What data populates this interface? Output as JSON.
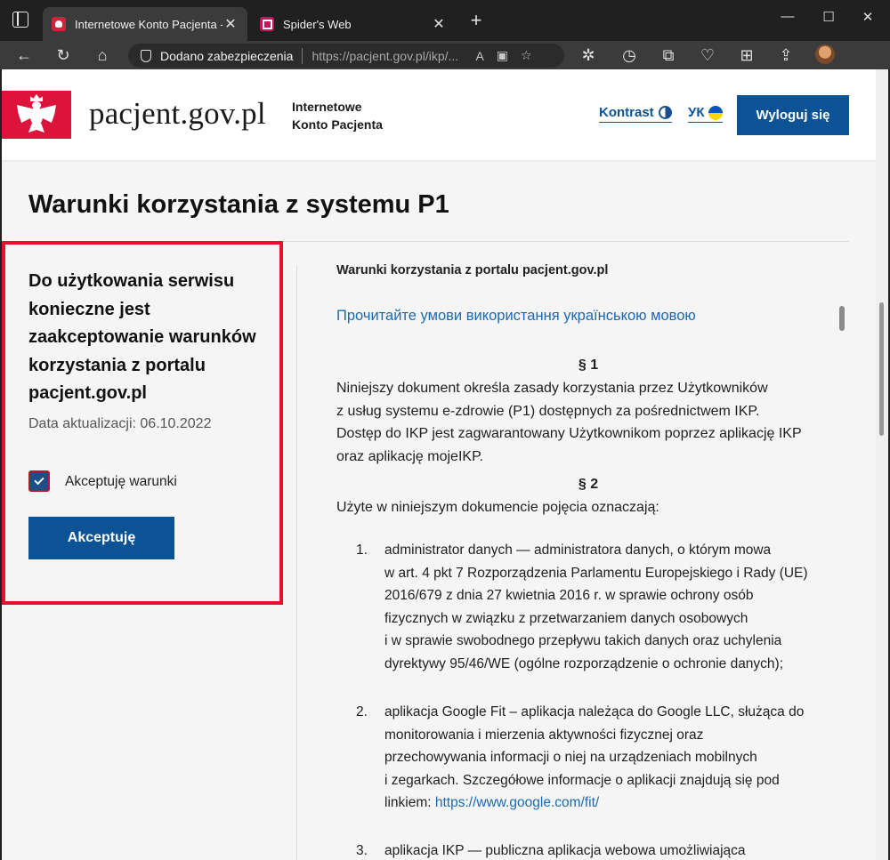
{
  "browser": {
    "tabs": [
      {
        "title": "Internetowe Konto Pacjenta - Wa",
        "active": true
      },
      {
        "title": "Spider's Web",
        "active": false
      }
    ],
    "address": {
      "security_label": "Dodano zabezpieczenia",
      "url": "https://pacjent.gov.pl/ikp/..."
    }
  },
  "header": {
    "brand": "pacjent.gov.pl",
    "subtitle_line1": "Internetowe",
    "subtitle_line2": "Konto Pacjenta",
    "contrast_label": "Kontrast",
    "lang_label": "УК",
    "logout_label": "Wyloguj się"
  },
  "page": {
    "title": "Warunki korzystania z systemu P1"
  },
  "panel": {
    "heading": "Do użytkowania serwisu konieczne jest zaakceptowanie warunków korzystania z portalu pacjent.gov.pl",
    "updated": "Data aktualizacji: 06.10.2022",
    "checkbox_label": "Akceptuję warunki",
    "checkbox_checked": true,
    "accept_label": "Akceptuję"
  },
  "terms": {
    "heading": "Warunki korzystania z portalu pacjent.gov.pl",
    "ua_link": "Прочитайте умови використання українською мовою",
    "p1_title": "§ 1",
    "p1_line1": "Niniejszy dokument określa zasady korzystania przez Użytkowników",
    "p1_line2": "z usług systemu e-zdrowie (P1) dostępnych za pośrednictwem IKP.",
    "p1_line3": "Dostęp do IKP jest zagwarantowany Użytkownikom poprzez aplikację IKP",
    "p1_line4": "oraz aplikację mojeIKP.",
    "p2_title": "§ 2",
    "p2_text": "Użyte w niniejszym dokumencie pojęcia oznaczają:",
    "items": [
      {
        "num": "1.",
        "lines": [
          "administrator danych — administratora danych, o którym mowa",
          "w art. 4 pkt 7 Rozporządzenia Parlamentu Europejskiego i Rady (UE)",
          "2016/679 z dnia 27 kwietnia 2016 r. w sprawie ochrony osób",
          "fizycznych w związku z przetwarzaniem danych osobowych",
          "i w sprawie swobodnego przepływu takich danych oraz uchylenia",
          "dyrektywy 95/46/WE (ogólne rozporządzenie o ochronie danych);"
        ]
      },
      {
        "num": "2.",
        "lines": [
          "aplikacja Google Fit – aplikacja należąca do Google LLC, służąca do",
          "monitorowania i mierzenia aktywności fizycznej oraz",
          "przechowywania informacji o niej na urządzeniach mobilnych",
          "i zegarkach. Szczegółowe informacje o aplikacji znajdują się pod"
        ],
        "link_prefix": "linkiem: ",
        "link": "https://www.google.com/fit/"
      },
      {
        "num": "3.",
        "lines": [
          "aplikacja IKP — publiczna aplikacja webowa umożliwiająca"
        ]
      }
    ]
  }
}
